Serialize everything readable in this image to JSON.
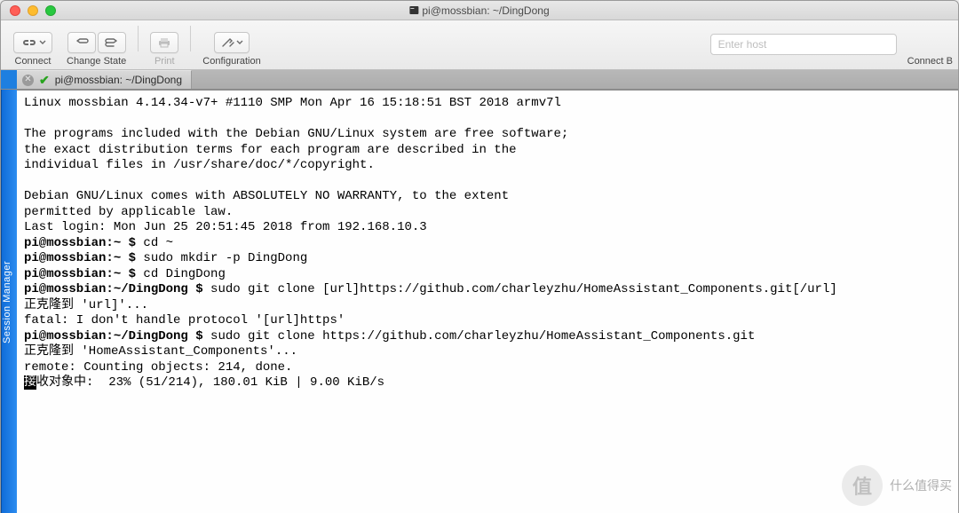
{
  "window": {
    "title": "pi@mossbian: ~/DingDong"
  },
  "toolbar": {
    "connect": {
      "label": "Connect"
    },
    "changeState": {
      "label": "Change State"
    },
    "print": {
      "label": "Print"
    },
    "configuration": {
      "label": "Configuration"
    },
    "connectBar": {
      "label": "Connect B"
    },
    "hostPlaceholder": "Enter host"
  },
  "tab": {
    "title": "pi@mossbian: ~/DingDong"
  },
  "sidebar": {
    "label": "Session Manager"
  },
  "terminal": {
    "lines": [
      {
        "t": "plain",
        "text": "Linux mossbian 4.14.34-v7+ #1110 SMP Mon Apr 16 15:18:51 BST 2018 armv7l"
      },
      {
        "t": "plain",
        "text": ""
      },
      {
        "t": "plain",
        "text": "The programs included with the Debian GNU/Linux system are free software;"
      },
      {
        "t": "plain",
        "text": "the exact distribution terms for each program are described in the"
      },
      {
        "t": "plain",
        "text": "individual files in /usr/share/doc/*/copyright."
      },
      {
        "t": "plain",
        "text": ""
      },
      {
        "t": "plain",
        "text": "Debian GNU/Linux comes with ABSOLUTELY NO WARRANTY, to the extent"
      },
      {
        "t": "plain",
        "text": "permitted by applicable law."
      },
      {
        "t": "plain",
        "text": "Last login: Mon Jun 25 20:51:45 2018 from 192.168.10.3"
      },
      {
        "t": "prompt",
        "user": "pi",
        "at": "@",
        "host": "mossbian",
        "path": ":~ $",
        "cmd": " cd ~"
      },
      {
        "t": "prompt",
        "user": "pi",
        "at": "@",
        "host": "mossbian",
        "path": ":~ $",
        "cmd": " sudo mkdir -p DingDong"
      },
      {
        "t": "prompt",
        "user": "pi",
        "at": "@",
        "host": "mossbian",
        "path": ":~ $",
        "cmd": " cd DingDong"
      },
      {
        "t": "prompt",
        "user": "pi",
        "at": "@",
        "host": "mossbian",
        "path": ":~/DingDong $",
        "cmd": " sudo git clone [url]https://github.com/charleyzhu/HomeAssistant_Components.git[/url]"
      },
      {
        "t": "plain",
        "text": "正克隆到 'url]'..."
      },
      {
        "t": "plain",
        "text": "fatal: I don't handle protocol '[url]https'"
      },
      {
        "t": "prompt",
        "user": "pi",
        "at": "@",
        "host": "mossbian",
        "path": ":~/DingDong $",
        "cmd": " sudo git clone https://github.com/charleyzhu/HomeAssistant_Components.git"
      },
      {
        "t": "plain",
        "text": "正克隆到 'HomeAssistant_Components'..."
      },
      {
        "t": "plain",
        "text": "remote: Counting objects: 214, done."
      },
      {
        "t": "progress",
        "inv": "接",
        "rest": "收对象中:  23% (51/214), 180.01 KiB | 9.00 KiB/s"
      }
    ]
  },
  "watermark": {
    "brand": "值",
    "text": "什么值得买"
  }
}
